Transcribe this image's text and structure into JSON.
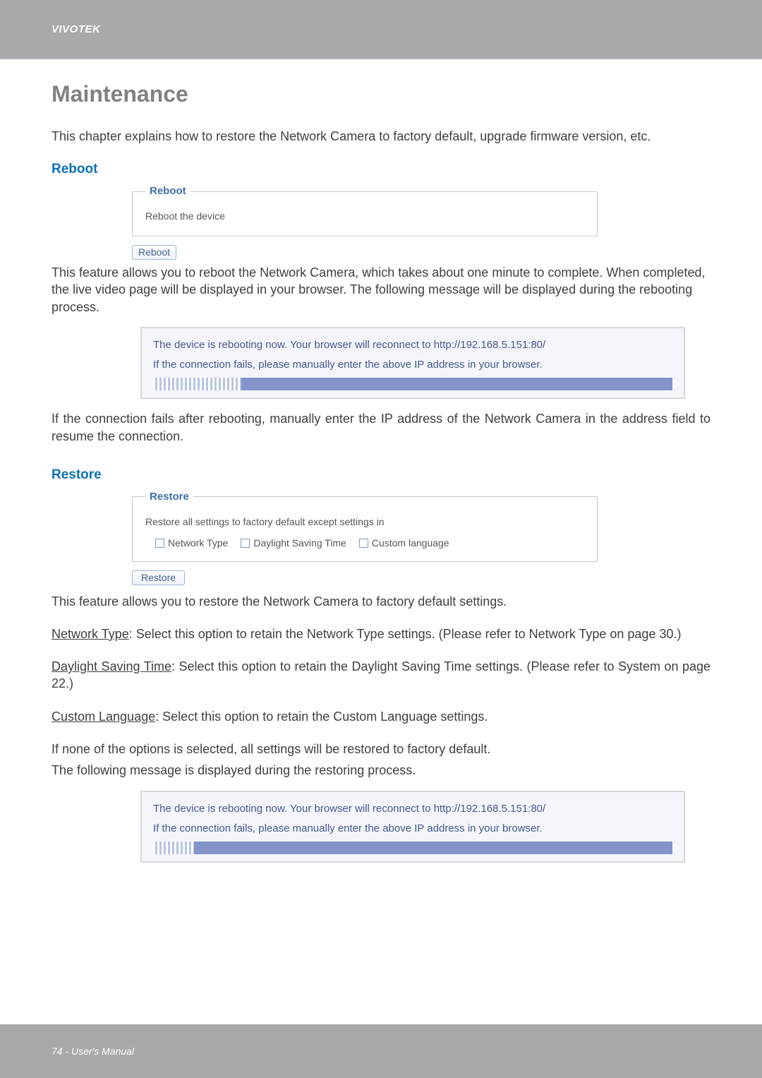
{
  "header": {
    "brand": "VIVOTEK"
  },
  "title": "Maintenance",
  "intro": "This chapter explains how to restore the Network Camera to factory default, upgrade firmware version, etc.",
  "reboot": {
    "heading": "Reboot",
    "legend": "Reboot",
    "panel_text": "Reboot the device",
    "button": "Reboot",
    "desc": "This feature allows you to reboot the Network Camera, which takes about one minute to complete. When completed, the live video page will be displayed in your browser. The following message will be displayed during the rebooting process.",
    "msg_line1": "The device is rebooting now. Your browser will reconnect to http://192.168.5.151:80/",
    "msg_line2": "If the connection fails, please manually enter the above IP address in your browser.",
    "after": "If the connection fails after rebooting, manually enter the IP address of the Network Camera in the address field to resume the connection."
  },
  "restore": {
    "heading": "Restore",
    "legend": "Restore",
    "panel_text": "Restore all settings to factory default except settings in",
    "options": {
      "network": "Network Type",
      "dst": "Daylight Saving Time",
      "lang": "Custom language"
    },
    "button": "Restore",
    "desc": "This feature allows you to restore the Network Camera to factory default settings.",
    "net_label": "Network Type",
    "net_text": ": Select this option to retain the Network Type settings. (Please refer to Network Type on page 30.)",
    "dst_label": "Daylight Saving Time",
    "dst_text": ": Select this option to retain the Daylight Saving Time settings. (Please refer to System on page 22.)",
    "lang_label": "Custom Language",
    "lang_text": ": Select this option to retain the Custom Language settings.",
    "none_text": "If none of the options is selected, all settings will be restored to factory default.",
    "follow_text": "The following message is displayed during the restoring process.",
    "msg_line1": "The device is rebooting now. Your browser will reconnect to http://192.168.5.151:80/",
    "msg_line2": "If the connection fails, please manually enter the above IP address in your browser."
  },
  "footer": {
    "text": "74 - User's Manual"
  }
}
